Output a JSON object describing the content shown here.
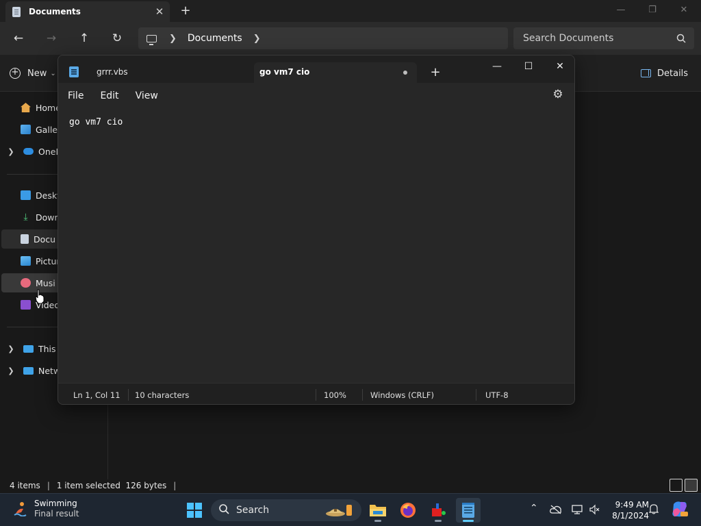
{
  "explorer": {
    "tab_title": "Documents",
    "breadcrumb": "Documents",
    "search_placeholder": "Search Documents",
    "new_label": "New",
    "details_label": "Details",
    "sidebar": {
      "home": "Home",
      "gallery": "Galler",
      "onedrive": "OneD",
      "desktop": "Deskt",
      "downloads": "Down",
      "documents": "Docu",
      "pictures": "Pictur",
      "music": "Musi",
      "videos": "Video",
      "this_pc": "This P",
      "network": "Netw"
    },
    "status": {
      "items": "4 items",
      "selected": "1 item selected  126 bytes"
    }
  },
  "notepad": {
    "tabs": [
      "grrr.vbs",
      "go vm7 cio"
    ],
    "menu": [
      "File",
      "Edit",
      "View"
    ],
    "content": "go vm7 cio",
    "status": {
      "position": "Ln 1, Col 11",
      "chars": "10 characters",
      "zoom": "100%",
      "line_ending": "Windows (CRLF)",
      "encoding": "UTF-8"
    }
  },
  "taskbar": {
    "widget_title": "Swimming",
    "widget_sub": "Final result",
    "search_label": "Search",
    "time": "9:49 AM",
    "date": "8/1/2024"
  },
  "colors": {
    "accent": "#60cdff",
    "notepad_bg": "#272727",
    "explorer_bg": "#191919",
    "taskbar_bg": "#1e2631"
  }
}
